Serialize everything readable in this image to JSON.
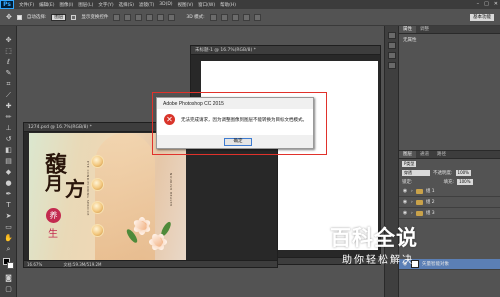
{
  "menubar": {
    "logo": "Ps",
    "items": [
      "文件(F)",
      "编辑(E)",
      "图像(I)",
      "图层(L)",
      "文字(Y)",
      "选择(S)",
      "滤镜(T)",
      "3D(D)",
      "视图(V)",
      "窗口(W)",
      "帮助(H)"
    ],
    "controls": [
      "–",
      "□",
      "✕"
    ]
  },
  "options": {
    "auto_select_label": "自动选择:",
    "auto_select_value": "图层",
    "show_transform_label": "显示变换控件",
    "mode_3d_label": "3D 模式:",
    "workspace": "基本功能"
  },
  "doc_white": {
    "tab": "未标题-1 @ 16.7%(RGB/8) *",
    "status": "16.67%"
  },
  "doc_image": {
    "tab": "1274.psd @ 16.7%(RGB/8) *",
    "status_zoom": "16.67%",
    "status_doc": "文档:59.3M/519.2M",
    "title_chars": [
      "馥",
      "月",
      "方"
    ],
    "yang": "养",
    "sheng": "生",
    "vertical_en_left": "EYE CONDITIONING SERVICE",
    "vertical_en_right": "NOURISH HEALTH"
  },
  "panels": {
    "props_tabs": [
      "属性",
      "调整"
    ],
    "props_title": "无属性",
    "layers_tabs": [
      "图层",
      "通道",
      "路径"
    ],
    "kind_label": "P类型",
    "blend_mode": "穿透",
    "opacity_label": "不透明度:",
    "opacity_value": "100%",
    "lock_label": "锁定:",
    "fill_label": "填充:",
    "fill_value": "100%",
    "layers": [
      {
        "name": "组 1",
        "type": "group"
      },
      {
        "name": "组 2",
        "type": "group"
      },
      {
        "name": "组 3",
        "type": "group"
      },
      {
        "name": "矢量智能对象",
        "type": "smart"
      }
    ]
  },
  "dialog": {
    "title": "Adobe Photoshop CC 2015",
    "message": "无法完成请求，因为调整图像到图层不能转换为目标文档模式。",
    "ok_label": "确定"
  },
  "watermark": {
    "main": "百科全说",
    "sub": "助你轻松解决"
  },
  "colors": {
    "error_red": "#d9352b",
    "highlight_outline": "#e0322b",
    "accent_pink": "#c32a4f"
  }
}
